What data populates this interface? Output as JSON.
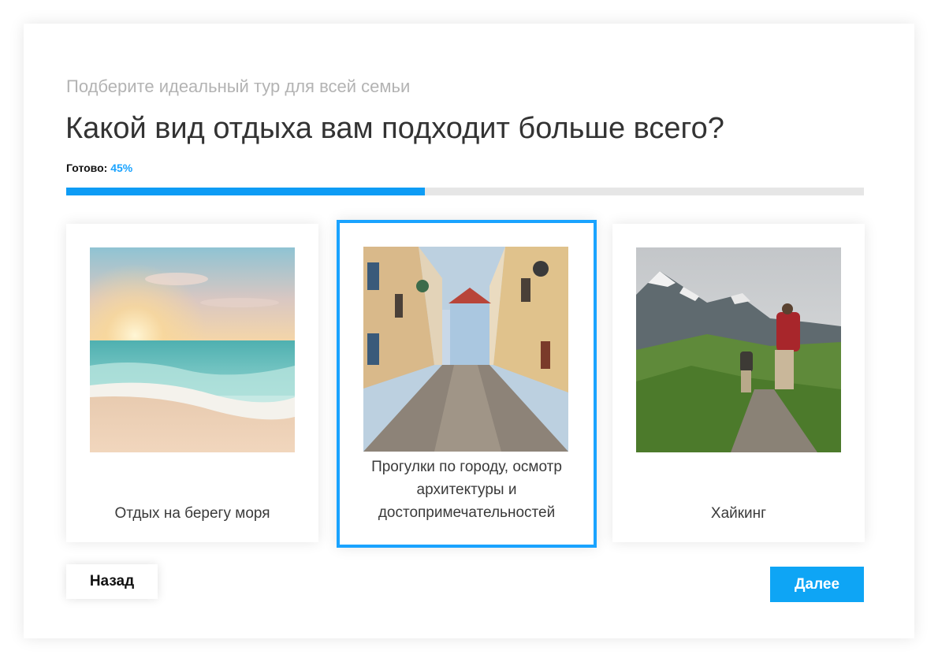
{
  "quiz": {
    "subtitle": "Подберите идеальный тур для всей семьи",
    "question": "Какой вид отдыха вам подходит больше всего?",
    "progress": {
      "label": "Готово:",
      "value_text": "45%",
      "fraction": 0.45
    }
  },
  "options": [
    {
      "label": "Отдых на берегу моря",
      "image": "beach-sunset-image",
      "selected": false
    },
    {
      "label": "Прогулки по городу, осмотр архитектуры и достопримечательностей",
      "image": "old-town-street-image",
      "selected": true
    },
    {
      "label": "Хайкинг",
      "image": "mountain-hiking-image",
      "selected": false
    }
  ],
  "buttons": {
    "back": "Назад",
    "next": "Далее"
  },
  "colors": {
    "accent": "#1aa3ff",
    "progress_fill": "#0e9cf5",
    "progress_track": "#e6e6e6",
    "next_button": "#0ea5f5"
  }
}
